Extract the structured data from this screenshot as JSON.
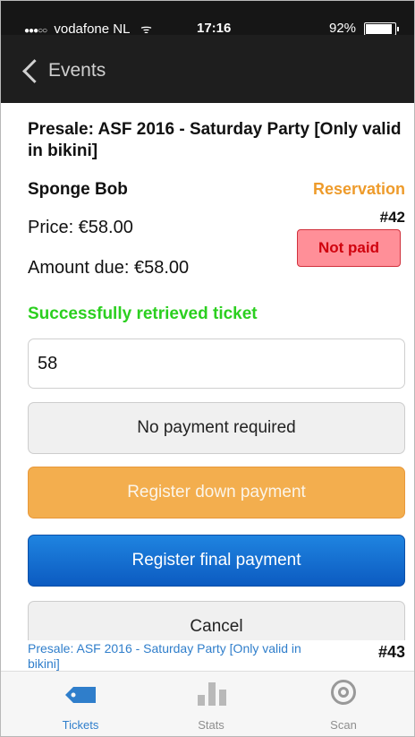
{
  "status_bar": {
    "signal": "●●●○○",
    "carrier": "vodafone NL",
    "time": "17:16",
    "battery": "92%"
  },
  "nav": {
    "back_label": "Events"
  },
  "ticket": {
    "event_title": "Presale: ASF 2016 - Saturday Party [Only valid in bikini]",
    "customer": "Sponge Bob",
    "type": "Reservation",
    "number": "#42",
    "price": "Price: €58.00",
    "amount_due": "Amount due: €58.00",
    "payment_status": "Not paid",
    "message": "Successfully retrieved ticket"
  },
  "form": {
    "amount_value": "58"
  },
  "buttons": {
    "no_payment": "No payment required",
    "down_payment": "Register down payment",
    "final_payment": "Register final payment",
    "cancel": "Cancel"
  },
  "next_ticket": {
    "title": "Presale: ASF 2016 - Saturday Party [Only valid in bikini]",
    "number": "#43"
  },
  "tabs": [
    {
      "label": "Tickets",
      "icon": "ticket-icon",
      "active": true
    },
    {
      "label": "Stats",
      "icon": "stats-icon",
      "active": false
    },
    {
      "label": "Scan",
      "icon": "scan-icon",
      "active": false
    }
  ],
  "colors": {
    "accent": "#2f7ecb",
    "success": "#2bcf1f",
    "reservation": "#ee9b2b",
    "not_paid_bg": "#ff8f98",
    "not_paid_text": "#d0020e",
    "down_payment": "#f3ae4e",
    "final_payment": "#0c5bc1"
  }
}
